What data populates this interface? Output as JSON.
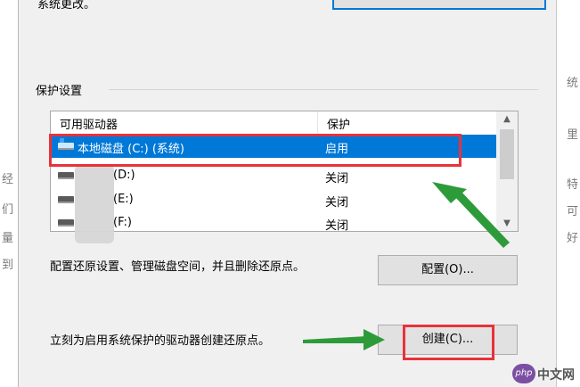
{
  "top": {
    "partial_text": "系统更改。"
  },
  "protection": {
    "group_label": "保护设置",
    "columns": {
      "drive": "可用驱动器",
      "protection": "保护"
    },
    "drives": [
      {
        "name": "本地磁盘 (C:) (系统)",
        "status": "启用",
        "selected": true
      },
      {
        "name": "(D:)",
        "status": "关闭",
        "selected": false
      },
      {
        "name": "(E:)",
        "status": "关闭",
        "selected": false
      },
      {
        "name": "(F:)",
        "status": "关闭",
        "selected": false
      }
    ],
    "configure_desc": "配置还原设置、管理磁盘空间，并且删除还原点。",
    "configure_label": "配置(O)...",
    "create_desc": "立刻为启用系统保护的驱动器创建还原点。",
    "create_label": "创建(C)..."
  },
  "background": {
    "right_chars": [
      "统",
      "里",
      "特",
      "可",
      "好"
    ],
    "left_chars": [
      "经",
      "们",
      "量",
      "到"
    ]
  },
  "watermark": {
    "badge": "php",
    "text": "中文网"
  },
  "colors": {
    "highlight": "#e8323a",
    "arrow": "#2e9b3a",
    "selection": "#0078d7"
  }
}
